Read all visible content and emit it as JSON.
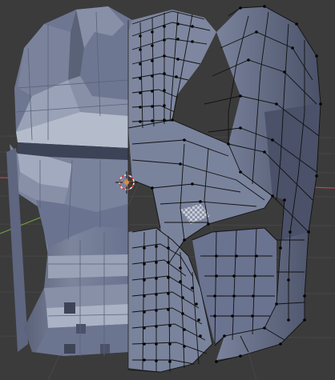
{
  "viewport": {
    "background_color": "#3b3b3b",
    "grid_color": "#4a4a4a",
    "x_axis_color": "#b5474a",
    "y_axis_color": "#6f9f3a"
  },
  "scene": {
    "object": "helmet-mesh",
    "left_half_shading": "smooth-faceted",
    "right_half_display": "wireframe-with-vertices",
    "mesh_color": "#6d7690",
    "mesh_highlight_color": "#a8b0c4",
    "mesh_dark_color": "#3e4456",
    "wire_color": "#111111",
    "vertex_color": "#000000",
    "selected_face_pattern": "checker",
    "cursor_icon": "3d-cursor-icon"
  }
}
